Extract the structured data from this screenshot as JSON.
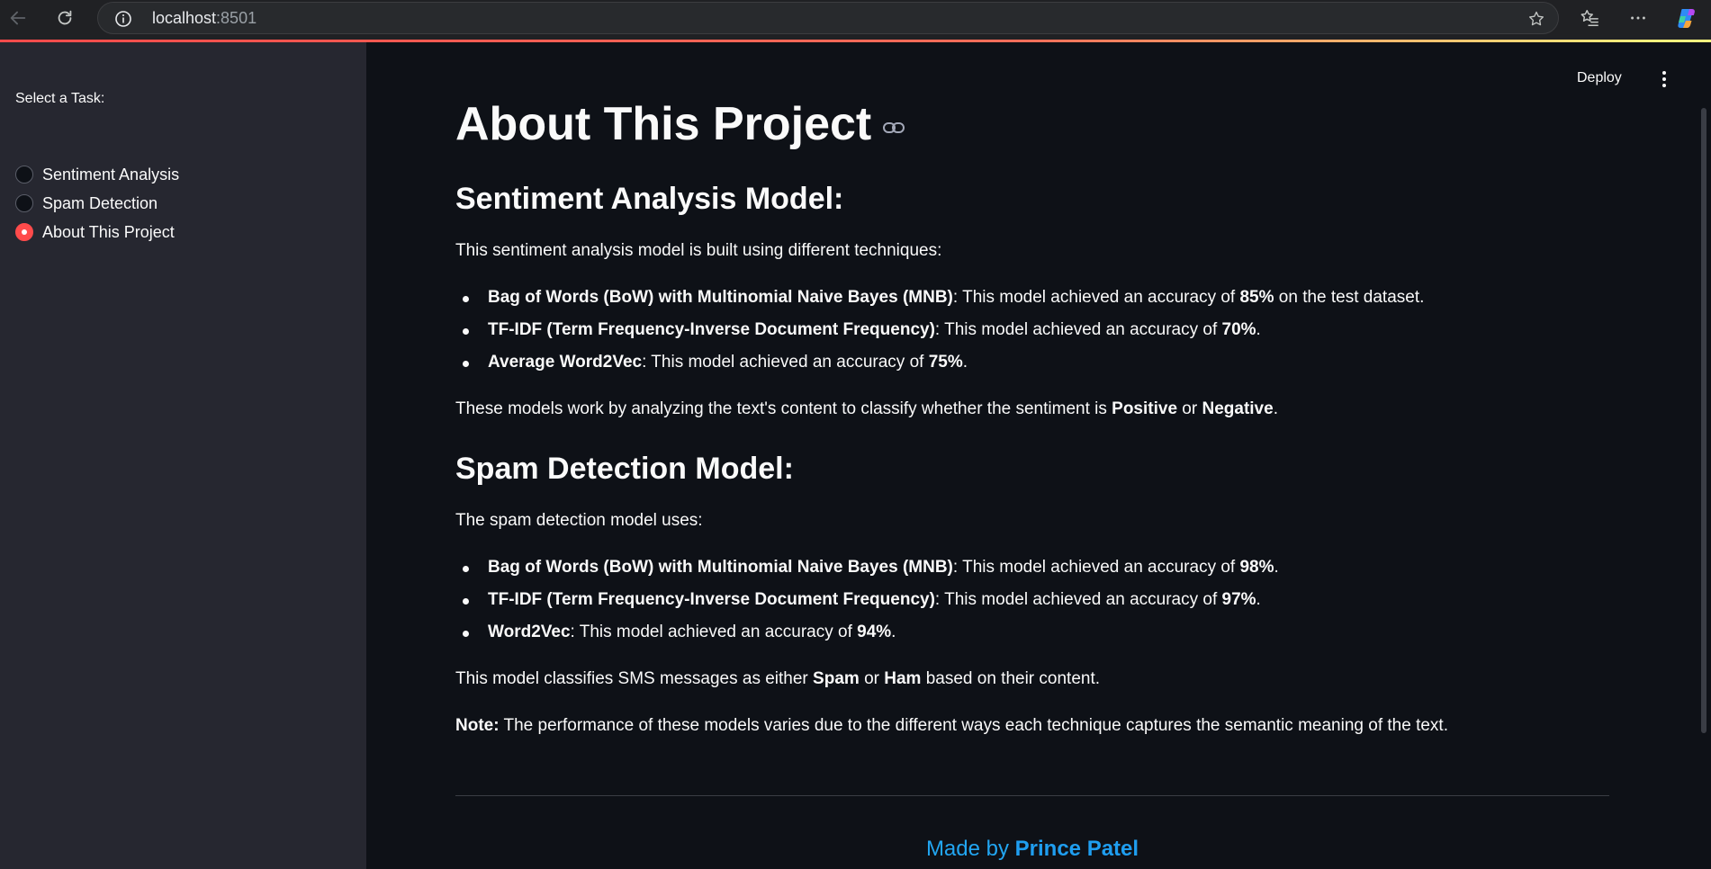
{
  "browser": {
    "url_host": "localhost",
    "url_port": ":8501"
  },
  "sidebar": {
    "task_label": "Select a Task:",
    "options": [
      {
        "label": "Sentiment Analysis",
        "selected": false
      },
      {
        "label": "Spam Detection",
        "selected": false
      },
      {
        "label": "About This Project",
        "selected": true
      }
    ]
  },
  "header": {
    "deploy_label": "Deploy"
  },
  "main": {
    "title": "About This Project",
    "sentiment": {
      "heading": "Sentiment Analysis Model:",
      "intro": "This sentiment analysis model is built using different techniques:",
      "bullets": [
        {
          "bold": "Bag of Words (BoW) with Multinomial Naive Bayes (MNB)",
          "text1": ": This model achieved an accuracy of ",
          "value": "85%",
          "text2": " on the test dataset."
        },
        {
          "bold": "TF-IDF (Term Frequency-Inverse Document Frequency)",
          "text1": ": This model achieved an accuracy of ",
          "value": "70%",
          "text2": "."
        },
        {
          "bold": "Average Word2Vec",
          "text1": ": This model achieved an accuracy of ",
          "value": "75%",
          "text2": "."
        }
      ],
      "summary_pre": "These models work by analyzing the text's content to classify whether the sentiment is ",
      "summary_b1": "Positive",
      "summary_mid": " or ",
      "summary_b2": "Negative",
      "summary_post": "."
    },
    "spam": {
      "heading": "Spam Detection Model:",
      "intro": "The spam detection model uses:",
      "bullets": [
        {
          "bold": "Bag of Words (BoW) with Multinomial Naive Bayes (MNB)",
          "text1": ": This model achieved an accuracy of ",
          "value": "98%",
          "text2": "."
        },
        {
          "bold": "TF-IDF (Term Frequency-Inverse Document Frequency)",
          "text1": ": This model achieved an accuracy of ",
          "value": "97%",
          "text2": "."
        },
        {
          "bold": "Word2Vec",
          "text1": ": This model achieved an accuracy of ",
          "value": "94%",
          "text2": "."
        }
      ],
      "summary_pre": "This model classifies SMS messages as either ",
      "summary_b1": "Spam",
      "summary_mid": " or ",
      "summary_b2": "Ham",
      "summary_post": " based on their content."
    },
    "note_label": "Note:",
    "note_text": " The performance of these models varies due to the different ways each technique captures the semantic meaning of the text.",
    "footer_pre": "Made by ",
    "footer_name": "Prince Patel"
  },
  "colors": {
    "accent": "#ff4b4b",
    "link": "#22a6f2",
    "background": "#0e1117",
    "sidebar": "#262730"
  },
  "icons": [
    "back-arrow-icon",
    "reload-icon",
    "info-icon",
    "star-icon",
    "favorites-icon",
    "more-icon",
    "copilot-icon",
    "link-icon",
    "kebab-menu-icon"
  ]
}
